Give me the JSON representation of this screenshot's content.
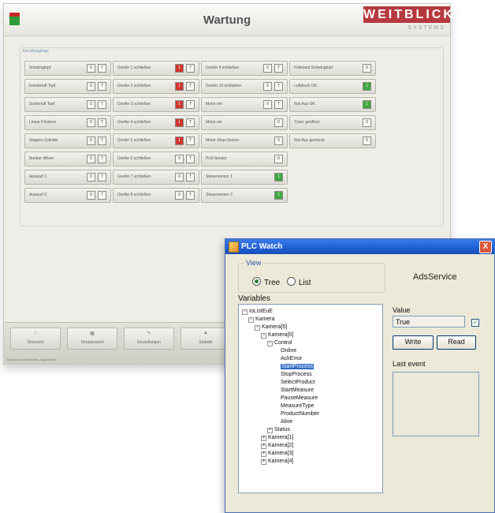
{
  "wartung": {
    "title": "Wartung",
    "logo_text": "WEITBLICK",
    "logo_sub": "SYSTEMS",
    "group_label": "Ein-/Ausgänge",
    "io_items": [
      {
        "label": "Schwingtopf",
        "buttons": [
          "0",
          "T"
        ]
      },
      {
        "label": "Entstörluft Topf",
        "buttons": [
          "0",
          "T"
        ]
      },
      {
        "label": "Sortierluft Topf",
        "buttons": [
          "0",
          "T"
        ]
      },
      {
        "label": "Linear Förderer",
        "buttons": [
          "0",
          "T"
        ]
      },
      {
        "label": "Stopper-Zylinder",
        "buttons": [
          "0",
          "T"
        ]
      },
      {
        "label": "Bunker öffnen",
        "buttons": [
          "0",
          "T"
        ]
      },
      {
        "label": "Auswurf 1",
        "buttons": [
          "0",
          "T"
        ]
      },
      {
        "label": "Auswurf 2",
        "buttons": [
          "0",
          "T"
        ]
      },
      {
        "label": "Greifer 1 schließen",
        "buttons": [
          "1",
          "T"
        ]
      },
      {
        "label": "Greifer 2 schließen",
        "buttons": [
          "1",
          "T"
        ]
      },
      {
        "label": "Greifer 3 schließen",
        "buttons": [
          "1",
          "T"
        ]
      },
      {
        "label": "Greifer 4 schließen",
        "buttons": [
          "1",
          "T"
        ]
      },
      {
        "label": "Greifer 5 schließen",
        "buttons": [
          "1",
          "T"
        ]
      },
      {
        "label": "Greifer 6 schließen",
        "buttons": [
          "0",
          "T"
        ]
      },
      {
        "label": "Greifer 7 schließen",
        "buttons": [
          "0",
          "T"
        ]
      },
      {
        "label": "Greifer 8 schließen",
        "buttons": [
          "0",
          "T"
        ]
      },
      {
        "label": "Greifer 9 schließen",
        "buttons": [
          "0",
          "T"
        ]
      },
      {
        "label": "Greifer 10 schließen",
        "buttons": [
          "0",
          "T"
        ]
      },
      {
        "label": "Motor ein",
        "buttons": [
          "0",
          "T"
        ]
      },
      {
        "label": "Motor ein",
        "buttons": [
          "0"
        ]
      },
      {
        "label": "Motor-Stop-Sensor",
        "buttons": [
          "0"
        ]
      },
      {
        "label": "Prüf-Sensor",
        "buttons": [
          "0"
        ]
      },
      {
        "label": "Steuersensor 1",
        "buttons": [
          "1"
        ]
      },
      {
        "label": "Steuersensor 2",
        "buttons": [
          "1"
        ]
      },
      {
        "label": "Füllstand Schwingtopf",
        "buttons": [
          "0"
        ]
      },
      {
        "label": "Luftdruck OK",
        "buttons": [
          "1"
        ]
      },
      {
        "label": "Not-Aus OK",
        "buttons": [
          "1"
        ]
      },
      {
        "label": "Türen geöffnet",
        "buttons": [
          "0"
        ]
      },
      {
        "label": "Not-Aus gedrückt",
        "buttons": [
          "0"
        ]
      }
    ],
    "nav": [
      {
        "label": "Übersicht",
        "icon": "⌂"
      },
      {
        "label": "Detailansicht",
        "icon": "▦"
      },
      {
        "label": "Einstellungen",
        "icon": "✎"
      },
      {
        "label": "Statistik",
        "icon": "▲"
      }
    ],
    "status_text": "Benutzer Administrator angemeldet"
  },
  "plc": {
    "title": "PLC Watch",
    "close_label": "X",
    "view_legend": "View",
    "radio_tree": "Tree",
    "radio_list": "List",
    "service": "AdsService",
    "variables_label": "Variables",
    "tree": [
      {
        "label": "IoListEuE",
        "exp": "−"
      },
      {
        "label": "Kamera",
        "exp": "−"
      },
      {
        "label": "Kamera[5]",
        "exp": "−"
      },
      {
        "label": "Kamera[0]",
        "exp": "−"
      },
      {
        "label": "Control",
        "exp": "−"
      },
      {
        "label": "Online",
        "exp": ""
      },
      {
        "label": "AckError",
        "exp": ""
      },
      {
        "label": "StartProcess",
        "exp": ""
      },
      {
        "label": "StopProcess",
        "exp": ""
      },
      {
        "label": "SelectProduct",
        "exp": ""
      },
      {
        "label": "StartMeasure",
        "exp": ""
      },
      {
        "label": "PauseMeasure",
        "exp": ""
      },
      {
        "label": "MeasureType",
        "exp": ""
      },
      {
        "label": "ProductNumber",
        "exp": ""
      },
      {
        "label": "Alive",
        "exp": ""
      },
      {
        "label": "Status",
        "exp": "+"
      },
      {
        "label": "Kamera[1]",
        "exp": "+"
      },
      {
        "label": "Kamera[2]",
        "exp": "+"
      },
      {
        "label": "Kamera[3]",
        "exp": "+"
      },
      {
        "label": "Kamera[4]",
        "exp": "+"
      }
    ],
    "value_label": "Value",
    "value": "True",
    "write_label": "Write",
    "read_label": "Read",
    "last_event_label": "Last event"
  }
}
